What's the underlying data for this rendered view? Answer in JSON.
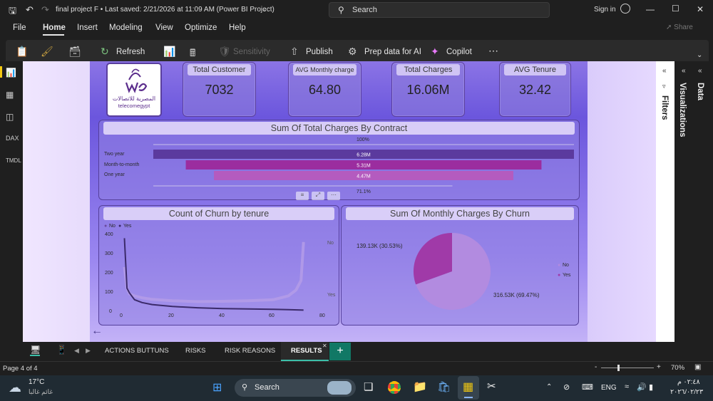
{
  "titlebar": {
    "doc_title": "final project F • Last saved: 2/21/2026 at 11:09 AM (Power BI Project)",
    "search_label": "Search",
    "signin_label": "Sign in"
  },
  "menu": [
    "File",
    "Home",
    "Insert",
    "Modeling",
    "View",
    "Optimize",
    "Help"
  ],
  "share_label": "Share",
  "ribbon": {
    "refresh": "Refresh",
    "sensitivity": "Sensitivity",
    "publish": "Publish",
    "prep_data": "Prep data for AI",
    "copilot": "Copilot"
  },
  "logo": {
    "brand": "we",
    "arabic": "المصرية للاتصالات",
    "english": "telecomegypt"
  },
  "kpis": [
    {
      "title": "Total Customer",
      "value": "7032"
    },
    {
      "title": "AVG Monthly charge",
      "value": "64.80"
    },
    {
      "title": "Total Charges",
      "value": "16.06M"
    },
    {
      "title": "AVG Tenure",
      "value": "32.42"
    }
  ],
  "bar_chart": {
    "title": "Sum Of Total Charges By Contract",
    "top_label": "100%",
    "bottom_label": "71.1%",
    "categories": [
      "Two year",
      "Month-to-month",
      "One year"
    ],
    "labels": [
      "6.28M",
      "5.31M",
      "4.47M"
    ]
  },
  "line_chart": {
    "title": "Count of Churn by tenure",
    "legend": [
      "No",
      "Yes"
    ],
    "yticks": [
      "400",
      "300",
      "200",
      "100",
      "0"
    ],
    "xticks": [
      "0",
      "20",
      "40",
      "60",
      "80"
    ],
    "end_labels": [
      "No",
      "Yes"
    ]
  },
  "pie_chart": {
    "title": "Sum Of Monthly Charges By Churn",
    "legend": [
      "No",
      "Yes"
    ],
    "label_yes": "139.13K (30.53%)",
    "label_no": "316.53K (69.47%)"
  },
  "chart_data": [
    {
      "type": "bar",
      "title": "Sum Of Total Charges By Contract",
      "categories": [
        "Two year",
        "Month-to-month",
        "One year"
      ],
      "values": [
        6.28,
        5.31,
        4.47
      ],
      "colors": [
        "#5b3a9e",
        "#9b2d9f",
        "#b45bbf"
      ]
    },
    {
      "type": "line",
      "title": "Count of Churn by tenure",
      "xlim": [
        0,
        80
      ],
      "ylim": [
        0,
        400
      ],
      "series": [
        {
          "name": "No",
          "x": [
            1,
            2,
            3,
            5,
            8,
            12,
            20,
            30,
            40,
            50,
            60,
            66,
            69,
            71,
            72
          ],
          "y": [
            230,
            120,
            90,
            80,
            70,
            62,
            55,
            50,
            52,
            55,
            60,
            80,
            110,
            160,
            360
          ]
        },
        {
          "name": "Yes",
          "x": [
            1,
            2,
            3,
            5,
            8,
            12,
            20,
            30,
            40,
            50,
            60,
            66,
            72
          ],
          "y": [
            380,
            120,
            95,
            60,
            45,
            35,
            25,
            18,
            14,
            12,
            10,
            8,
            6
          ]
        }
      ]
    },
    {
      "type": "pie",
      "title": "Sum Of Monthly Charges By Churn",
      "categories": [
        "No",
        "Yes"
      ],
      "values": [
        316.53,
        139.13
      ],
      "colors": [
        "#b28be0",
        "#a03aa8"
      ]
    }
  ],
  "tabs": [
    "ACTIONS BUTTUNS",
    "RISKS",
    "RISK REASONS",
    "RESULTS"
  ],
  "status": {
    "page": "Page 4 of 4",
    "zoom": "70%"
  },
  "panes": {
    "filters": "Filters",
    "visualizations": "Visualizations",
    "data": "Data"
  },
  "taskbar": {
    "temp": "17°C",
    "weather": "غائم غالبا",
    "search": "Search",
    "lang": "ENG",
    "time": "٠٢:٤٨ م",
    "date": "٢٠٢٦/٠٢/٢٣"
  }
}
